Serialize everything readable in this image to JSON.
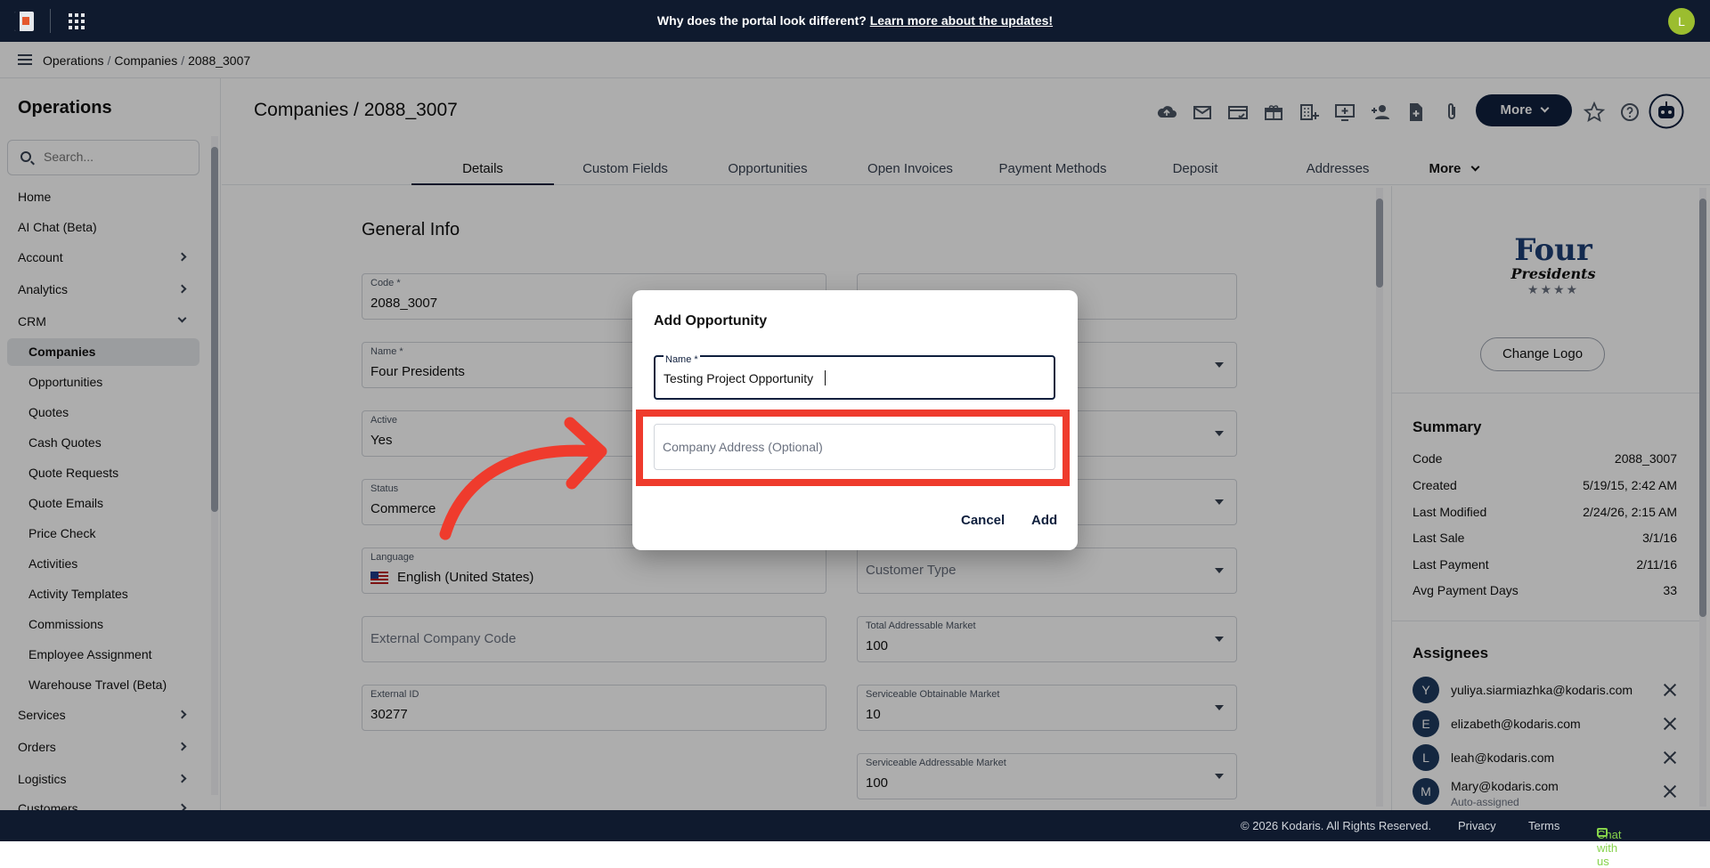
{
  "topbar": {
    "banner_question": "Why does the portal look different?",
    "banner_link": "Learn more about the updates!",
    "user_initial": "L"
  },
  "breadcrumbs": [
    "Operations",
    "Companies",
    "2088_3007"
  ],
  "sidebar": {
    "title": "Operations",
    "search_placeholder": "Search...",
    "items": [
      {
        "label": "Home"
      },
      {
        "label": "AI Chat (Beta)"
      },
      {
        "label": "Account"
      },
      {
        "label": "Analytics"
      },
      {
        "label": "CRM"
      },
      {
        "label": "Companies"
      },
      {
        "label": "Opportunities"
      },
      {
        "label": "Quotes"
      },
      {
        "label": "Cash Quotes"
      },
      {
        "label": "Quote Requests"
      },
      {
        "label": "Quote Emails"
      },
      {
        "label": "Price Check"
      },
      {
        "label": "Activities"
      },
      {
        "label": "Activity Templates"
      },
      {
        "label": "Commissions"
      },
      {
        "label": "Employee Assignment"
      },
      {
        "label": "Warehouse Travel (Beta)"
      },
      {
        "label": "Services"
      },
      {
        "label": "Orders"
      },
      {
        "label": "Logistics"
      },
      {
        "label": "Customers"
      }
    ]
  },
  "header": {
    "title": "Companies / 2088_3007",
    "more_label": "More",
    "tabs": [
      "Details",
      "Custom Fields",
      "Opportunities",
      "Open Invoices",
      "Payment Methods",
      "Deposit",
      "Addresses",
      "More"
    ]
  },
  "form": {
    "section_title": "General Info",
    "code_label": "Code *",
    "code_value": "2088_3007",
    "name_label": "Name *",
    "name_value": "Four Presidents",
    "active_label": "Active",
    "active_value": "Yes",
    "status_label": "Status",
    "status_value": "Commerce",
    "language_label": "Language",
    "language_value": "English (United States)",
    "external_code_placeholder": "External Company Code",
    "external_id_label": "External ID",
    "external_id_value": "30277",
    "customer_type_placeholder": "Customer Type",
    "tam_label": "Total Addressable Market",
    "tam_value": "100",
    "som_label": "Serviceable Obtainable Market",
    "som_value": "10",
    "sam_label": "Serviceable Addressable Market",
    "sam_value": "100"
  },
  "right_panel": {
    "logo_line1": "Four",
    "logo_line2": "Presidents",
    "logo_stars": "★★★★",
    "change_logo": "Change Logo",
    "summary_title": "Summary",
    "summary": [
      {
        "k": "Code",
        "v": "2088_3007"
      },
      {
        "k": "Created",
        "v": "5/19/15, 2:42 AM"
      },
      {
        "k": "Last Modified",
        "v": "2/24/26, 2:15 AM"
      },
      {
        "k": "Last Sale",
        "v": "3/1/16"
      },
      {
        "k": "Last Payment",
        "v": "2/11/16"
      },
      {
        "k": "Avg Payment Days",
        "v": "33"
      }
    ],
    "assignees_title": "Assignees",
    "assignees": [
      {
        "initial": "Y",
        "email": "yuliya.siarmiazhka@kodaris.com"
      },
      {
        "initial": "E",
        "email": "elizabeth@kodaris.com"
      },
      {
        "initial": "L",
        "email": "leah@kodaris.com"
      },
      {
        "initial": "M",
        "email": "Mary@kodaris.com",
        "sub": "Auto-assigned"
      }
    ]
  },
  "footer": {
    "copyright": "© 2026 Kodaris. All Rights Reserved.",
    "privacy": "Privacy",
    "terms": "Terms",
    "chat": "Chat with us"
  },
  "modal": {
    "title": "Add Opportunity",
    "name_label": "Name *",
    "name_value": "Testing Project Opportunity",
    "address_placeholder": "Company Address (Optional)",
    "cancel": "Cancel",
    "add": "Add"
  },
  "colors": {
    "navy": "#0f1f3d",
    "annotation_red": "#ef3b2d",
    "chat_green": "#86d34b"
  }
}
